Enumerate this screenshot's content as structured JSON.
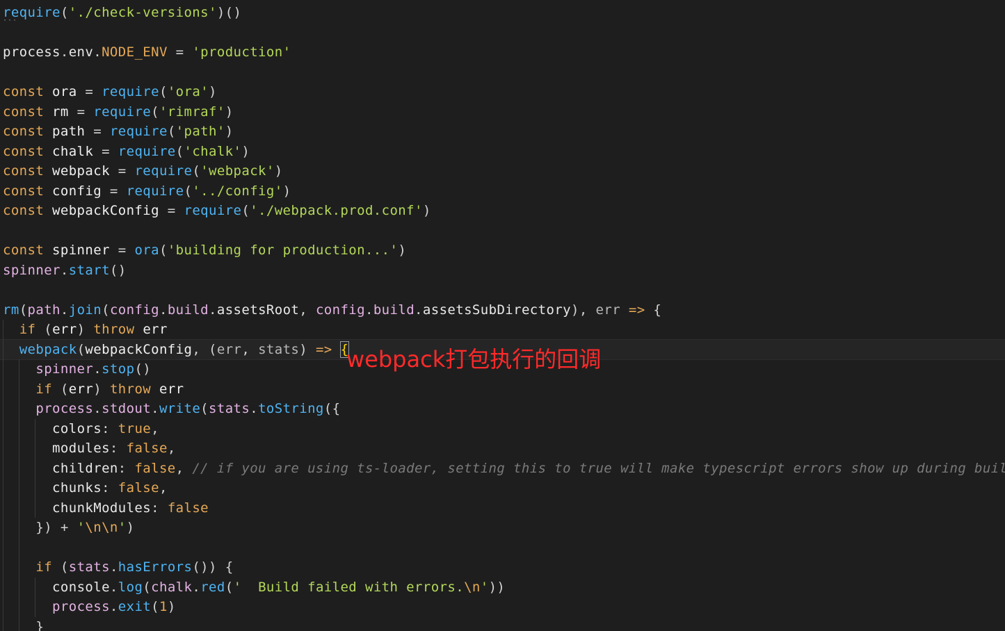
{
  "colors": {
    "background": "#1e1e1e",
    "keyword": "#e6a957",
    "function": "#4fb4f3",
    "string": "#b4d85a",
    "comment": "#7a7a7a",
    "annotation": "#ff2a2a"
  },
  "annotation": {
    "text": "webpack打包执行的回调"
  },
  "lines": [
    {
      "indent": 0,
      "tokens": [
        [
          "fn",
          "require"
        ],
        [
          "pun",
          "("
        ],
        [
          "str",
          "'./check-versions'"
        ],
        [
          "pun",
          ")()"
        ]
      ]
    },
    {
      "indent": 0,
      "tokens": []
    },
    {
      "indent": 0,
      "tokens": [
        [
          "obj",
          "process"
        ],
        [
          "pun",
          "."
        ],
        [
          "obj",
          "env"
        ],
        [
          "pun",
          "."
        ],
        [
          "env",
          "NODE_ENV"
        ],
        [
          "pun",
          " = "
        ],
        [
          "str",
          "'production'"
        ]
      ]
    },
    {
      "indent": 0,
      "tokens": []
    },
    {
      "indent": 0,
      "tokens": [
        [
          "kw",
          "const"
        ],
        [
          "var",
          " ora "
        ],
        [
          "pun",
          "= "
        ],
        [
          "fn",
          "require"
        ],
        [
          "pun",
          "("
        ],
        [
          "str",
          "'ora'"
        ],
        [
          "pun",
          ")"
        ]
      ]
    },
    {
      "indent": 0,
      "tokens": [
        [
          "kw",
          "const"
        ],
        [
          "var",
          " rm "
        ],
        [
          "pun",
          "= "
        ],
        [
          "fn",
          "require"
        ],
        [
          "pun",
          "("
        ],
        [
          "str",
          "'rimraf'"
        ],
        [
          "pun",
          ")"
        ]
      ]
    },
    {
      "indent": 0,
      "tokens": [
        [
          "kw",
          "const"
        ],
        [
          "var",
          " path "
        ],
        [
          "pun",
          "= "
        ],
        [
          "fn",
          "require"
        ],
        [
          "pun",
          "("
        ],
        [
          "str",
          "'path'"
        ],
        [
          "pun",
          ")"
        ]
      ]
    },
    {
      "indent": 0,
      "tokens": [
        [
          "kw",
          "const"
        ],
        [
          "var",
          " chalk "
        ],
        [
          "pun",
          "= "
        ],
        [
          "fn",
          "require"
        ],
        [
          "pun",
          "("
        ],
        [
          "str",
          "'chalk'"
        ],
        [
          "pun",
          ")"
        ]
      ]
    },
    {
      "indent": 0,
      "tokens": [
        [
          "kw",
          "const"
        ],
        [
          "var",
          " webpack "
        ],
        [
          "pun",
          "= "
        ],
        [
          "fn",
          "require"
        ],
        [
          "pun",
          "("
        ],
        [
          "str",
          "'webpack'"
        ],
        [
          "pun",
          ")"
        ]
      ]
    },
    {
      "indent": 0,
      "tokens": [
        [
          "kw",
          "const"
        ],
        [
          "var",
          " config "
        ],
        [
          "pun",
          "= "
        ],
        [
          "fn",
          "require"
        ],
        [
          "pun",
          "("
        ],
        [
          "str",
          "'../config'"
        ],
        [
          "pun",
          ")"
        ]
      ]
    },
    {
      "indent": 0,
      "tokens": [
        [
          "kw",
          "const"
        ],
        [
          "var",
          " webpackConfig "
        ],
        [
          "pun",
          "= "
        ],
        [
          "fn",
          "require"
        ],
        [
          "pun",
          "("
        ],
        [
          "str",
          "'./webpack.prod.conf'"
        ],
        [
          "pun",
          ")"
        ]
      ]
    },
    {
      "indent": 0,
      "tokens": []
    },
    {
      "indent": 0,
      "tokens": [
        [
          "kw",
          "const"
        ],
        [
          "var",
          " spinner "
        ],
        [
          "pun",
          "= "
        ],
        [
          "fn",
          "ora"
        ],
        [
          "pun",
          "("
        ],
        [
          "str",
          "'building for production...'"
        ],
        [
          "pun",
          ")"
        ]
      ]
    },
    {
      "indent": 0,
      "tokens": [
        [
          "obj2",
          "spinner"
        ],
        [
          "pun",
          "."
        ],
        [
          "fn",
          "start"
        ],
        [
          "pun",
          "()"
        ]
      ]
    },
    {
      "indent": 0,
      "tokens": []
    },
    {
      "indent": 0,
      "tokens": [
        [
          "fn",
          "rm"
        ],
        [
          "pun",
          "("
        ],
        [
          "obj2",
          "path"
        ],
        [
          "pun",
          "."
        ],
        [
          "fn",
          "join"
        ],
        [
          "pun",
          "("
        ],
        [
          "obj2",
          "config"
        ],
        [
          "pun",
          "."
        ],
        [
          "obj2",
          "build"
        ],
        [
          "pun",
          "."
        ],
        [
          "prop",
          "assetsRoot"
        ],
        [
          "pun",
          ", "
        ],
        [
          "obj2",
          "config"
        ],
        [
          "pun",
          "."
        ],
        [
          "obj2",
          "build"
        ],
        [
          "pun",
          "."
        ],
        [
          "prop",
          "assetsSubDirectory"
        ],
        [
          "pun",
          "), "
        ],
        [
          "prm",
          "err"
        ],
        [
          "pun",
          " "
        ],
        [
          "arrow",
          "=>"
        ],
        [
          "pun",
          " {"
        ]
      ]
    },
    {
      "indent": 1,
      "tokens": [
        [
          "kw",
          "if"
        ],
        [
          "pun",
          " ("
        ],
        [
          "var",
          "err"
        ],
        [
          "pun",
          ") "
        ],
        [
          "kw",
          "throw"
        ],
        [
          "var",
          " err"
        ]
      ]
    },
    {
      "indent": 1,
      "current": true,
      "tokens": [
        [
          "fn",
          "webpack"
        ],
        [
          "pun",
          "("
        ],
        [
          "var",
          "webpackConfig"
        ],
        [
          "pun",
          ", ("
        ],
        [
          "prm",
          "err"
        ],
        [
          "pun",
          ", "
        ],
        [
          "prm",
          "stats"
        ],
        [
          "pun",
          ") "
        ],
        [
          "arrow",
          "=>"
        ],
        [
          "pun",
          " "
        ],
        [
          "brace",
          "{"
        ]
      ]
    },
    {
      "indent": 2,
      "tokens": [
        [
          "obj2",
          "spinner"
        ],
        [
          "pun",
          "."
        ],
        [
          "fn",
          "stop"
        ],
        [
          "pun",
          "()"
        ]
      ]
    },
    {
      "indent": 2,
      "tokens": [
        [
          "kw",
          "if"
        ],
        [
          "pun",
          " ("
        ],
        [
          "var",
          "err"
        ],
        [
          "pun",
          ") "
        ],
        [
          "kw",
          "throw"
        ],
        [
          "var",
          " err"
        ]
      ]
    },
    {
      "indent": 2,
      "tokens": [
        [
          "obj2",
          "process"
        ],
        [
          "pun",
          "."
        ],
        [
          "obj2",
          "stdout"
        ],
        [
          "pun",
          "."
        ],
        [
          "fn",
          "write"
        ],
        [
          "pun",
          "("
        ],
        [
          "obj2",
          "stats"
        ],
        [
          "pun",
          "."
        ],
        [
          "fn",
          "toString"
        ],
        [
          "pun",
          "({"
        ]
      ]
    },
    {
      "indent": 3,
      "tokens": [
        [
          "prop",
          "colors"
        ],
        [
          "pun",
          ": "
        ],
        [
          "bool",
          "true"
        ],
        [
          "pun",
          ","
        ]
      ]
    },
    {
      "indent": 3,
      "tokens": [
        [
          "prop",
          "modules"
        ],
        [
          "pun",
          ": "
        ],
        [
          "bool",
          "false"
        ],
        [
          "pun",
          ","
        ]
      ]
    },
    {
      "indent": 3,
      "tokens": [
        [
          "prop",
          "children"
        ],
        [
          "pun",
          ": "
        ],
        [
          "bool",
          "false"
        ],
        [
          "pun",
          ", "
        ],
        [
          "cmt",
          "// if you are using ts-loader, setting this to true will make typescript errors show up during build"
        ]
      ]
    },
    {
      "indent": 3,
      "tokens": [
        [
          "prop",
          "chunks"
        ],
        [
          "pun",
          ": "
        ],
        [
          "bool",
          "false"
        ],
        [
          "pun",
          ","
        ]
      ]
    },
    {
      "indent": 3,
      "tokens": [
        [
          "prop",
          "chunkModules"
        ],
        [
          "pun",
          ": "
        ],
        [
          "bool",
          "false"
        ]
      ]
    },
    {
      "indent": 2,
      "tokens": [
        [
          "pun",
          "}) + "
        ],
        [
          "str",
          "'"
        ],
        [
          "esc",
          "\\n\\n"
        ],
        [
          "str",
          "'"
        ],
        [
          "pun",
          ")"
        ]
      ]
    },
    {
      "indent": 2,
      "tokens": []
    },
    {
      "indent": 2,
      "tokens": [
        [
          "kw",
          "if"
        ],
        [
          "pun",
          " ("
        ],
        [
          "obj2",
          "stats"
        ],
        [
          "pun",
          "."
        ],
        [
          "fn",
          "hasErrors"
        ],
        [
          "pun",
          "()) {"
        ]
      ]
    },
    {
      "indent": 3,
      "tokens": [
        [
          "obj",
          "console"
        ],
        [
          "pun",
          "."
        ],
        [
          "fn",
          "log"
        ],
        [
          "pun",
          "("
        ],
        [
          "obj2",
          "chalk"
        ],
        [
          "pun",
          "."
        ],
        [
          "fn",
          "red"
        ],
        [
          "pun",
          "("
        ],
        [
          "str",
          "'  Build failed with errors."
        ],
        [
          "esc",
          "\\n"
        ],
        [
          "str",
          "'"
        ],
        [
          "pun",
          "))"
        ]
      ]
    },
    {
      "indent": 3,
      "tokens": [
        [
          "obj2",
          "process"
        ],
        [
          "pun",
          "."
        ],
        [
          "fn",
          "exit"
        ],
        [
          "pun",
          "("
        ],
        [
          "num",
          "1"
        ],
        [
          "pun",
          ")"
        ]
      ]
    },
    {
      "indent": 2,
      "tokens": [
        [
          "pun",
          "}"
        ]
      ]
    }
  ]
}
